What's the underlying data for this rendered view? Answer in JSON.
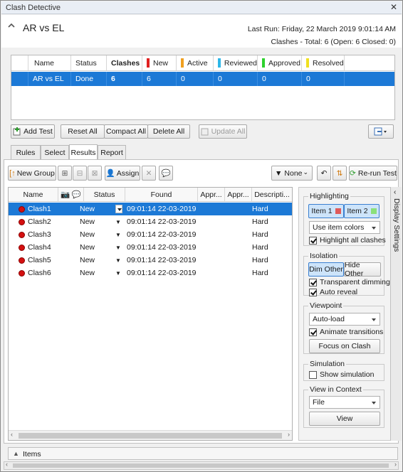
{
  "window": {
    "title": "Clash Detective"
  },
  "header": {
    "test_name": "AR vs EL",
    "last_run": "Last Run:  Friday, 22 March 2019 9:01:14 AM",
    "clash_summary": "Clashes -  Total: 6  (Open: 6  Closed: 0)"
  },
  "test_grid": {
    "columns": [
      "Name",
      "Status",
      "Clashes",
      "New",
      "Active",
      "Reviewed",
      "Approved",
      "Resolved"
    ],
    "status_colors": {
      "New": "#e02020",
      "Active": "#f0a020",
      "Reviewed": "#2db7e8",
      "Approved": "#2ed12e",
      "Resolved": "#f0e020"
    },
    "rows": [
      {
        "name": "AR vs EL",
        "status": "Done",
        "clashes": "6",
        "new": "6",
        "active": "0",
        "reviewed": "0",
        "approved": "0",
        "resolved": "0"
      }
    ]
  },
  "test_buttons": {
    "add_test": "Add Test",
    "reset_all": "Reset All",
    "compact_all": "Compact All",
    "delete_all": "Delete All",
    "update_all": "Update All"
  },
  "tabs": [
    "Rules",
    "Select",
    "Results",
    "Report"
  ],
  "active_tab": "Results",
  "results_toolbar": {
    "new_group": "New Group",
    "assign": "Assign",
    "filter": "None",
    "rerun": "Re-run Test"
  },
  "results": {
    "columns": [
      "Name",
      "Status",
      "Found",
      "Appr...",
      "Appr...",
      "Descripti..."
    ],
    "rows": [
      {
        "name": "Clash1",
        "status": "New",
        "found": "09:01:14 22-03-2019",
        "desc": "Hard",
        "selected": true
      },
      {
        "name": "Clash2",
        "status": "New",
        "found": "09:01:14 22-03-2019",
        "desc": "Hard",
        "selected": false
      },
      {
        "name": "Clash3",
        "status": "New",
        "found": "09:01:14 22-03-2019",
        "desc": "Hard",
        "selected": false
      },
      {
        "name": "Clash4",
        "status": "New",
        "found": "09:01:14 22-03-2019",
        "desc": "Hard",
        "selected": false
      },
      {
        "name": "Clash5",
        "status": "New",
        "found": "09:01:14 22-03-2019",
        "desc": "Hard",
        "selected": false
      },
      {
        "name": "Clash6",
        "status": "New",
        "found": "09:01:14 22-03-2019",
        "desc": "Hard",
        "selected": false
      }
    ]
  },
  "display_settings": {
    "tab_label": "Display Settings",
    "highlighting": {
      "title": "Highlighting",
      "item1": "Item 1",
      "item2": "Item 2",
      "item1_color": "#e05a5a",
      "item2_color": "#8be07a",
      "colors_select": "Use item colors",
      "highlight_all": "Highlight all clashes"
    },
    "isolation": {
      "title": "Isolation",
      "dim_other": "Dim Other",
      "hide_other": "Hide Other",
      "transparent_dimming": "Transparent dimming",
      "auto_reveal": "Auto reveal"
    },
    "viewpoint": {
      "title": "Viewpoint",
      "mode": "Auto-load",
      "animate": "Animate transitions",
      "focus": "Focus on Clash"
    },
    "simulation": {
      "title": "Simulation",
      "show": "Show simulation"
    },
    "view_in_context": {
      "title": "View in Context",
      "mode": "File",
      "view": "View"
    }
  },
  "items_panel": {
    "label": "Items"
  }
}
